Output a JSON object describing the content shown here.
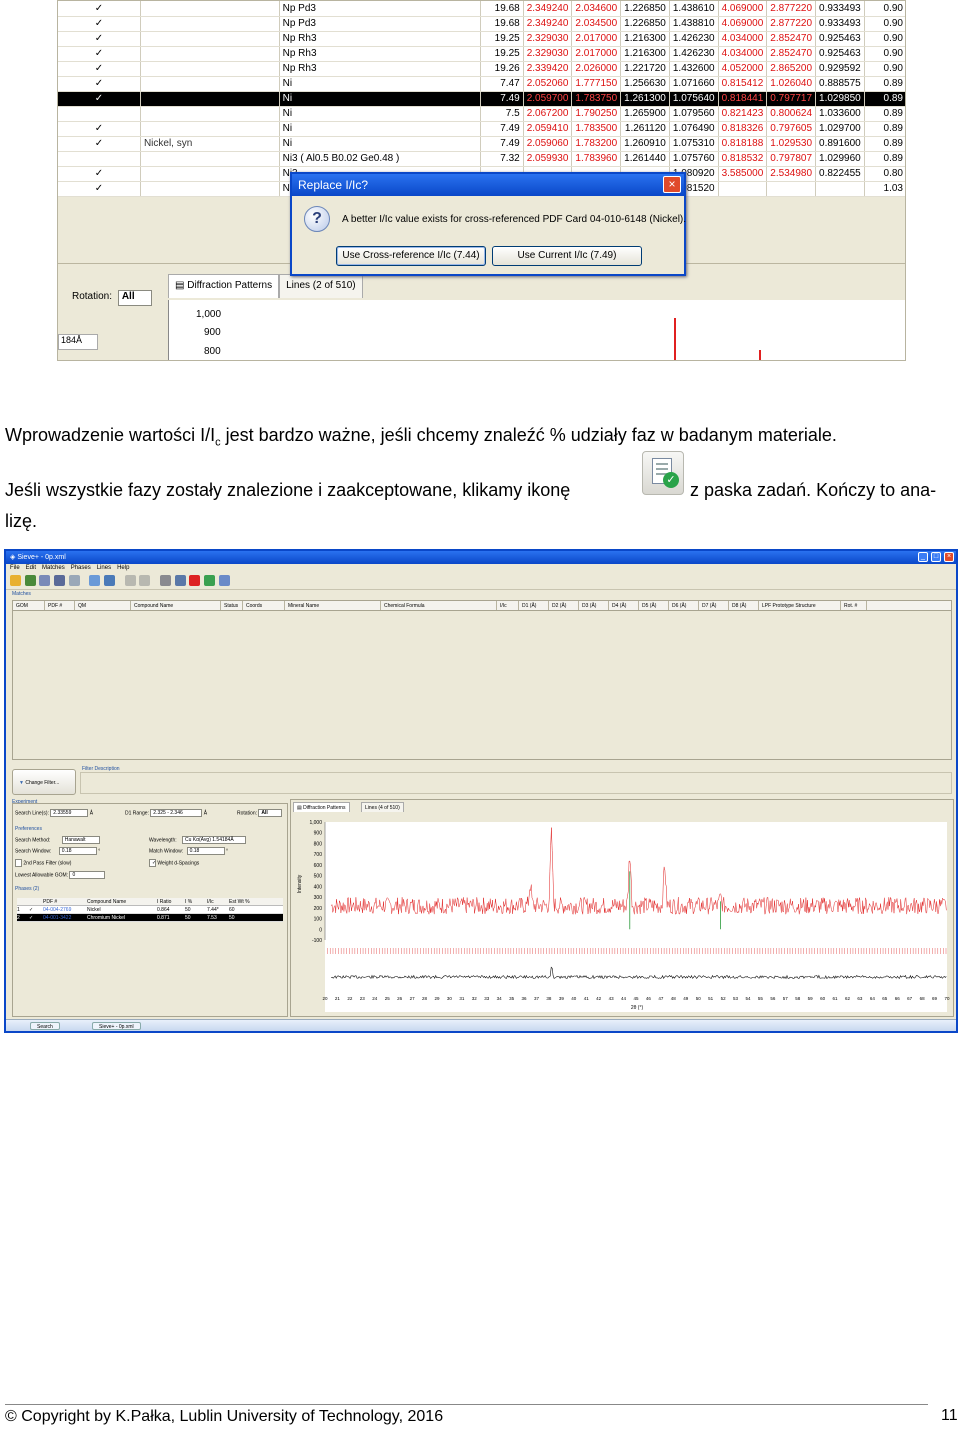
{
  "screenshot_top": {
    "rows": [
      {
        "check": "✓",
        "name": "",
        "formula": "Np Pd3",
        "ic": "19.68",
        "d": [
          "2.349240",
          "2.034600",
          "1.226850",
          "1.438610",
          "4.069000",
          "2.877220",
          "0.933493",
          "0.90"
        ]
      },
      {
        "check": "✓",
        "name": "",
        "formula": "Np Pd3",
        "ic": "19.68",
        "d": [
          "2.349240",
          "2.034500",
          "1.226850",
          "1.438810",
          "4.069000",
          "2.877220",
          "0.933493",
          "0.90"
        ]
      },
      {
        "check": "✓",
        "name": "",
        "formula": "Np Rh3",
        "ic": "19.25",
        "d": [
          "2.329030",
          "2.017000",
          "1.216300",
          "1.426230",
          "4.034000",
          "2.852470",
          "0.925463",
          "0.90"
        ]
      },
      {
        "check": "✓",
        "name": "",
        "formula": "Np Rh3",
        "ic": "19.25",
        "d": [
          "2.329030",
          "2.017000",
          "1.216300",
          "1.426230",
          "4.034000",
          "2.852470",
          "0.925463",
          "0.90"
        ]
      },
      {
        "check": "✓",
        "name": "",
        "formula": "Np Rh3",
        "ic": "19.26",
        "d": [
          "2.339420",
          "2.026000",
          "1.221720",
          "1.432600",
          "4.052000",
          "2.865200",
          "0.929592",
          "0.90"
        ]
      },
      {
        "check": "✓",
        "name": "",
        "formula": "Ni",
        "ic": "7.47",
        "d": [
          "2.052060",
          "1.777150",
          "1.256630",
          "1.071660",
          "0.815412",
          "1.026040",
          "0.888575",
          "0.89"
        ]
      },
      {
        "check": "✓",
        "name": "",
        "formula": "Ni",
        "ic": "7.49",
        "d": [
          "2.059700",
          "1.783750",
          "1.261300",
          "1.075640",
          "0.818441",
          "0.797717",
          "1.029850",
          "0.89"
        ],
        "selected": true
      },
      {
        "check": "",
        "name": "",
        "formula": "Ni",
        "ic": "7.5",
        "d": [
          "2.067200",
          "1.790250",
          "1.265900",
          "1.079560",
          "0.821423",
          "0.800624",
          "1.033600",
          "0.89"
        ]
      },
      {
        "check": "✓",
        "name": "",
        "formula": "Ni",
        "ic": "7.49",
        "d": [
          "2.059410",
          "1.783500",
          "1.261120",
          "1.076490",
          "0.818326",
          "0.797605",
          "1.029700",
          "0.89"
        ]
      },
      {
        "check": "✓",
        "name": "Nickel, syn",
        "formula": "Ni",
        "ic": "7.49",
        "d": [
          "2.059060",
          "1.783200",
          "1.260910",
          "1.075310",
          "0.818188",
          "1.029530",
          "0.891600",
          "0.89"
        ]
      },
      {
        "check": "",
        "name": "",
        "formula": "Ni3 ( Al0.5 B0.02 Ge0.48 )",
        "ic": "7.32",
        "d": [
          "2.059930",
          "1.783960",
          "1.261440",
          "1.075760",
          "0.818532",
          "0.797807",
          "1.029960",
          "0.89"
        ]
      },
      {
        "check": "✓",
        "name": "",
        "formula": "Ni3",
        "ic": "",
        "d": [
          "",
          "",
          "",
          "1.080920",
          "3.585000",
          "2.534980",
          "0.822455",
          "0.80"
        ]
      },
      {
        "check": "✓",
        "name": "",
        "formula": "Ni3",
        "ic": "",
        "d": [
          "",
          "",
          "",
          "1.081520",
          "",
          "",
          "",
          "1.03"
        ]
      }
    ],
    "dialog": {
      "title": "Replace I/Ic?",
      "close_glyph": "×",
      "icon_glyph": "?",
      "message": "A better I/Ic value exists for cross-referenced PDF Card 04-010-6148 (Nickel).",
      "btn_cross": "Use Cross-reference I/Ic (7.44)",
      "btn_current": "Use Current I/Ic (7.49)"
    },
    "rotation_label": "Rotation:",
    "rotation_value": "All",
    "left_value": "184Å",
    "tab_patterns": "Diffraction Patterns",
    "tab_lines": "Lines (2 of 510)",
    "y_ticks": [
      "1,000",
      "900",
      "800"
    ]
  },
  "text": {
    "p1_pre": "Wprowadzenie wartości I/I",
    "p1_sub": "c",
    "p1_post": " jest bardzo ważne, jeśli chcemy znaleźć % udziały faz w badanym materiale.",
    "p2_a": "Jeśli wszystkie fazy zostały znalezione i zaakceptowane, klikamy ikonę",
    "p2_b": "z paska zadań. Kończy to ana-",
    "p2_c": "lizę."
  },
  "screenshot_bottom": {
    "title": "Sieve+ - 0p.xml",
    "menu": [
      "File",
      "Edit",
      "Matches",
      "Phases",
      "Lines",
      "Help"
    ],
    "matches_label": "Matches",
    "columns": [
      "GOM",
      "PDF #",
      "QM",
      "Compound Name",
      "Status",
      "Coords",
      "Mineral Name",
      "Chemical Formula",
      "I/Ic",
      "D1 (Å)",
      "D2 (Å)",
      "D3 (Å)",
      "D4 (Å)",
      "D5 (Å)",
      "D6 (Å)",
      "D7 (Å)",
      "D8 (Å)",
      "LPF Prototype Structure",
      "Rot. #"
    ],
    "change_filter": "Change Filter...",
    "filter_desc": "Filter Description",
    "experiment_label": "Experiment",
    "search_lines_label": "Search Line(s):",
    "search_lines_value": "2.33559",
    "unit_a": "Å",
    "d1_range_label": "D1 Range:",
    "d1_range_value": "2.325 - 2.346",
    "rotation_label": "Rotation:",
    "rotation_value": "All",
    "preferences_label": "Preferences",
    "search_method_label": "Search Method:",
    "search_method_value": "Hanawalt",
    "wavelength_label": "Wavelength:",
    "wavelength_value": "Cu Kα(Avg) 1.54184Å",
    "search_window_label": "Search Window:",
    "search_window_value": "0.18",
    "match_window_label": "Match Window:",
    "match_window_value": "0.18",
    "deg": "°",
    "second_pass": "2nd Pass Filter (slow)",
    "weight_d": "Weight d-Spacings",
    "lowest_gom_label": "Lowest Allowable GOM:",
    "lowest_gom_value": "0",
    "phases_label": "Phases (2)",
    "phase_headers": [
      "",
      "",
      "PDF #",
      "Compound Name",
      "I Ratio",
      "I %",
      "I/Ic",
      "Est Wt %"
    ],
    "phases": [
      {
        "n": "1",
        "chk": "✓",
        "pdf": "04-004-2769",
        "name": "Nickel",
        "ratio": "0.864",
        "pct": "50",
        "ic": "7.44*",
        "wt": "60"
      },
      {
        "n": "2",
        "chk": "✓",
        "pdf": "04-001-3422",
        "name": "Chromium Nickel",
        "ratio": "0.871",
        "pct": "50",
        "ic": "7.53",
        "wt": "50"
      }
    ],
    "tab_patterns": "Diffraction Patterns",
    "tab_lines": "Lines (4 of 510)",
    "taskbar_search": "Search",
    "taskbar_app": "Sieve+ - 0p.xml"
  },
  "chart_data": {
    "type": "line",
    "title": "",
    "ylabel": "Intensity",
    "xlabel": "2θ (°)",
    "ylim": [
      -100,
      1000
    ],
    "xlim": [
      20,
      70
    ],
    "y_ticks": [
      1000,
      900,
      800,
      700,
      600,
      500,
      400,
      300,
      200,
      100,
      0,
      -100
    ],
    "y_tick_labels": [
      "1,000",
      "900",
      "800",
      "700",
      "600",
      "500",
      "400",
      "300",
      "200",
      "100",
      "0",
      "-100"
    ],
    "x_ticks": [
      20,
      21,
      22,
      23,
      24,
      25,
      26,
      27,
      28,
      29,
      30,
      31,
      32,
      33,
      34,
      35,
      36,
      37,
      38,
      39,
      40,
      41,
      42,
      43,
      44,
      45,
      46,
      47,
      48,
      49,
      50,
      51,
      52,
      53,
      54,
      55,
      56,
      57,
      58,
      59,
      60,
      61,
      62,
      63,
      64,
      65,
      66,
      67,
      68,
      69,
      70
    ],
    "peaks": [
      {
        "x": 38.2,
        "y": 880
      },
      {
        "x": 44.5,
        "y": 700
      },
      {
        "x": 47.3,
        "y": 600
      },
      {
        "x": 51.8,
        "y": 300
      },
      {
        "x": 36.5,
        "y": 420
      }
    ],
    "baseline": 220,
    "noise": 80
  },
  "footer": {
    "copyright": "© Copyright by K.Pałka, Lublin University of Technology, 2016",
    "page": "11"
  },
  "colors": {
    "xp_blue": "#0a47c8",
    "pattern_red": "#e02020",
    "selected_row": "#000000"
  }
}
